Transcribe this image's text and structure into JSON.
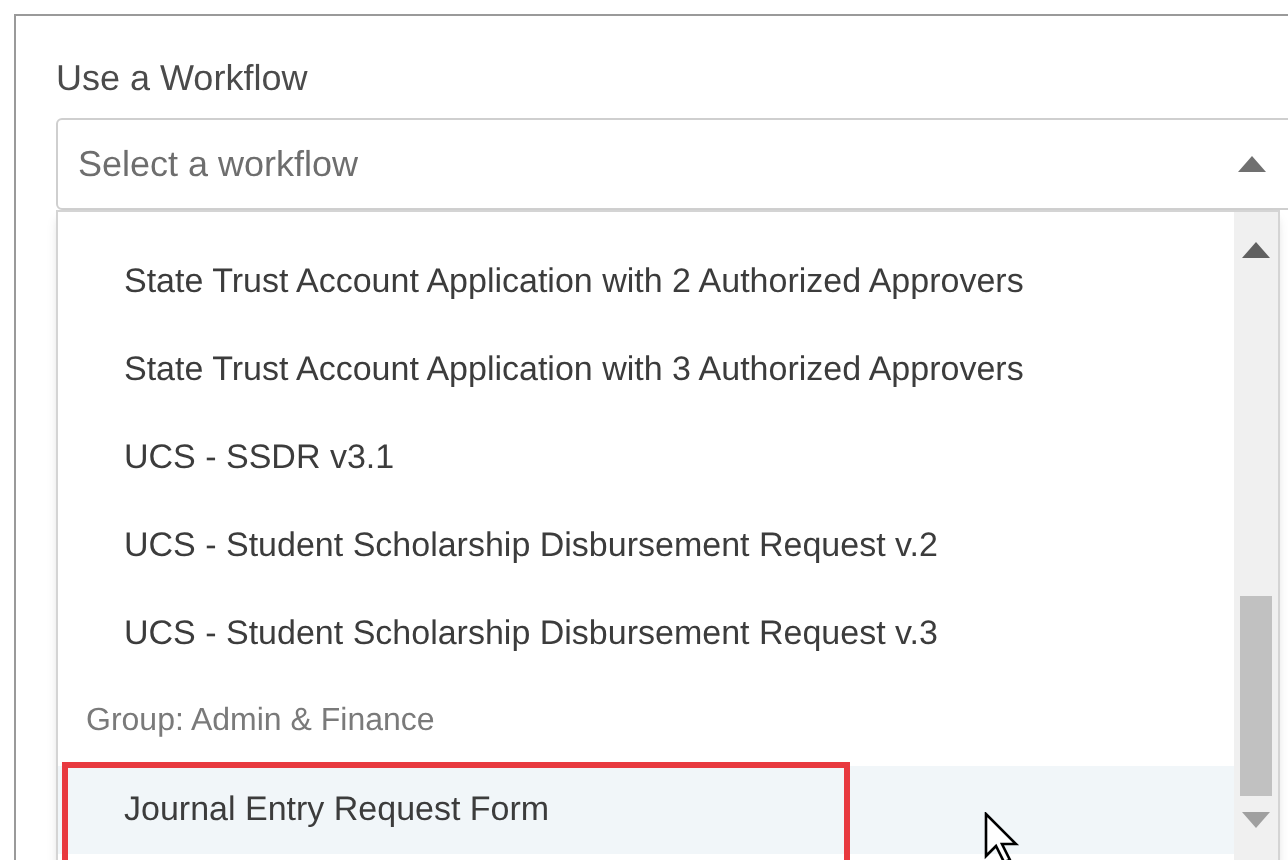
{
  "label": "Use a Workflow",
  "select": {
    "placeholder": "Select a workflow",
    "expanded": true
  },
  "options": [
    {
      "kind": "item",
      "text": "State Trust Account Application with 2 Authorized Approvers",
      "selected": false,
      "annotated": false
    },
    {
      "kind": "item",
      "text": "State Trust Account Application with 3 Authorized Approvers",
      "selected": false,
      "annotated": false
    },
    {
      "kind": "item",
      "text": "UCS - SSDR v3.1",
      "selected": false,
      "annotated": false
    },
    {
      "kind": "item",
      "text": "UCS - Student Scholarship Disbursement Request v.2",
      "selected": false,
      "annotated": false
    },
    {
      "kind": "item",
      "text": "UCS - Student Scholarship Disbursement Request v.3",
      "selected": false,
      "annotated": false
    },
    {
      "kind": "group",
      "text": "Group: Admin & Finance"
    },
    {
      "kind": "item",
      "text": "Journal Entry Request Form",
      "selected": true,
      "annotated": true
    }
  ]
}
